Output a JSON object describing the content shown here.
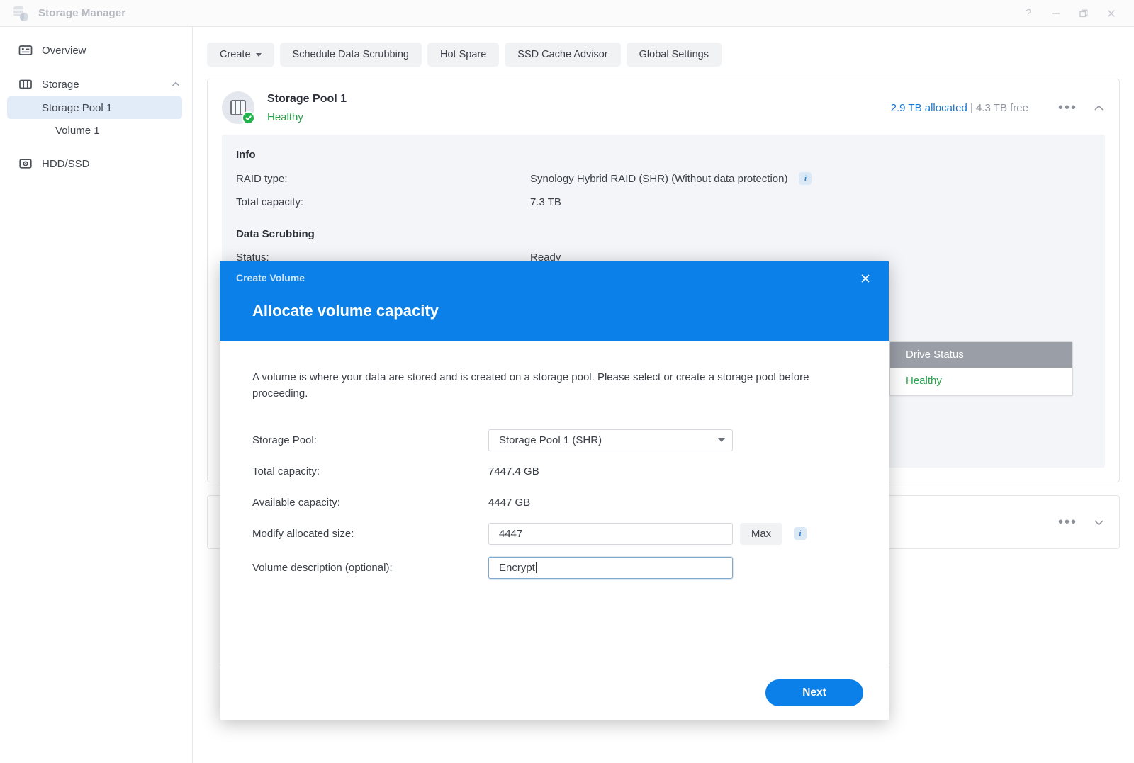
{
  "window": {
    "title": "Storage Manager",
    "app_icon": "storage-manager-icon",
    "controls": {
      "help": "?",
      "minimize": "–",
      "restore": "restore-icon",
      "close": "×"
    }
  },
  "sidebar": {
    "items": [
      {
        "label": "Overview",
        "icon": "overview-icon",
        "type": "item"
      },
      {
        "label": "Storage",
        "icon": "storage-icon",
        "type": "group",
        "chevron": "chevron-up-icon"
      },
      {
        "label": "Storage Pool 1",
        "type": "sub",
        "selected": true
      },
      {
        "label": "Volume 1",
        "type": "sub2",
        "selected": false
      },
      {
        "label": "HDD/SSD",
        "icon": "hdd-ssd-icon",
        "type": "item"
      }
    ]
  },
  "toolbar": {
    "buttons": [
      {
        "label": "Create",
        "caret": true
      },
      {
        "label": "Schedule Data Scrubbing",
        "caret": false
      },
      {
        "label": "Hot Spare",
        "caret": false
      },
      {
        "label": "SSD Cache Advisor",
        "caret": false
      },
      {
        "label": "Global Settings",
        "caret": false
      }
    ]
  },
  "pool_card": {
    "title": "Storage Pool 1",
    "status": "Healthy",
    "status_icon": "check-circle-icon",
    "pool_icon": "drive-bay-icon",
    "capacity_allocated": "2.9 TB allocated",
    "capacity_separator": "|",
    "capacity_free": "4.3 TB free",
    "more_icon": "ellipsis-icon",
    "collapse_icon": "chevron-up-icon",
    "info": {
      "section_title": "Info",
      "rows": [
        {
          "key": "RAID type:",
          "value": "Synology Hybrid RAID (SHR) (Without data protection)",
          "info_badge": "i"
        },
        {
          "key": "Total capacity:",
          "value": "7.3 TB",
          "info_badge": ""
        }
      ]
    },
    "data_scrubbing": {
      "section_title": "Data Scrubbing",
      "rows": [
        {
          "key": "Status:",
          "value": "Ready",
          "info_badge": ""
        }
      ]
    }
  },
  "drive_table": {
    "header": "Drive Status",
    "rows": [
      "Healthy"
    ]
  },
  "collapsed_card": {
    "more_icon": "ellipsis-icon",
    "expand_icon": "chevron-down-icon"
  },
  "modal": {
    "window_label": "Create Volume",
    "close_icon": "close-icon",
    "title": "Allocate volume capacity",
    "description": "A volume is where your data are stored and is created on a storage pool. Please select or create a storage pool before proceeding.",
    "fields": {
      "storage_pool_label": "Storage Pool:",
      "storage_pool_value": "Storage Pool 1 (SHR)",
      "storage_pool_caret": "chevron-down-icon",
      "total_capacity_label": "Total capacity:",
      "total_capacity_value": "7447.4 GB",
      "available_capacity_label": "Available capacity:",
      "available_capacity_value": "4447 GB",
      "allocated_size_label": "Modify allocated size:",
      "allocated_size_value": "4447",
      "allocated_size_placeholder": "",
      "max_button": "Max",
      "allocated_info_badge": "i",
      "description_label": "Volume description (optional):",
      "description_value": "Encrypt",
      "description_placeholder": ""
    },
    "footer": {
      "next_button": "Next"
    }
  },
  "colors": {
    "accent_blue": "#0b80e8",
    "link_blue": "#1a78d2",
    "healthy_green": "#2aa24a",
    "selected_nav": "#e2ecf8",
    "panel_grey": "#f3f5f8",
    "table_header_grey": "#9a9ea6"
  }
}
